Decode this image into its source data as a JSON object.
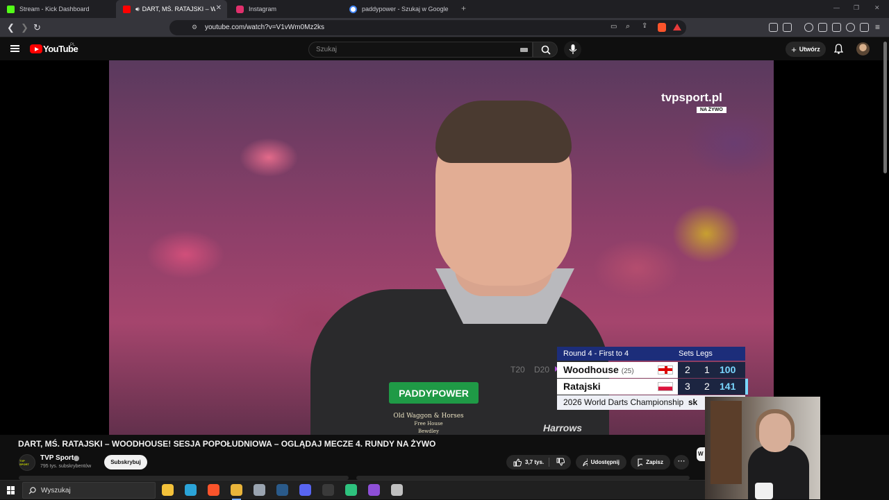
{
  "browser": {
    "tabs": [
      {
        "label": "Stream - Kick Dashboard",
        "favicon_color": "#53fc18",
        "active": false
      },
      {
        "label": "DART, MŚ. RATAJSKI – WOOD",
        "favicon_color": "#ff0000",
        "active": true,
        "muted_icon": "speaker-icon"
      },
      {
        "label": "Instagram",
        "favicon_color": "#e1306c",
        "active": false
      },
      {
        "label": "paddypower - Szukaj w Google",
        "favicon_color": "#4285f4",
        "active": false
      }
    ],
    "new_tab_symbol": "+",
    "tab_close_symbol": "✕",
    "url": "youtube.com/watch?v=V1vWm0Mz2ks"
  },
  "youtube": {
    "logo_text": "YouTube",
    "logo_region": "PL",
    "search_placeholder": "Szukaj",
    "create_label": "Utwórz"
  },
  "video": {
    "watermark": "tvpsport.pl",
    "live_tag": "NA ŻYWO",
    "sponsor": "PADDYPOWER",
    "shirt_line1": "Old Waggon & Horses",
    "shirt_line2": "Free House",
    "shirt_line3": "Bewdley",
    "shirt_harrows": "Harrows",
    "ghost_t20": "T20",
    "ghost_d20": "D20",
    "scoreboard": {
      "round": "Round 4 - First to 4",
      "sets_legs": "Sets Legs",
      "players": [
        {
          "name": "Woodhouse",
          "seed": "(25)",
          "country": "England",
          "sets": "2",
          "legs": "1",
          "points": "100",
          "throwing": true
        },
        {
          "name": "Ratajski",
          "seed": "",
          "country": "Poland",
          "sets": "3",
          "legs": "2",
          "points": "141",
          "throwing": false
        }
      ],
      "event": "2026 World Darts Championship",
      "event_suffix": "sk"
    }
  },
  "info": {
    "title": "DART, MŚ. RATAJSKI – WOODHOUSE! SESJA POPOŁUDNIOWA – OGLĄDAJ MECZE 4. RUNDY NA ŻYWO",
    "channel_name": "TVP Sport",
    "channel_avatar_text": "TVP SPORT",
    "subscribers": "795 tys. subskrybentów",
    "subscribe_label": "Subskrybuj",
    "likes": "3,7 tys.",
    "share_label": "Udostępnij",
    "save_label": "Zapisz",
    "more_label": "⋯",
    "chip_letter": "W"
  },
  "taskbar": {
    "search_placeholder": "Wyszukaj",
    "apps": [
      {
        "name": "file-explorer",
        "color": "#f3c13a"
      },
      {
        "name": "edge",
        "color": "#2ba4d8"
      },
      {
        "name": "brave",
        "color": "#fb542b"
      },
      {
        "name": "chrome",
        "color": "#e9b43a"
      },
      {
        "name": "app-generic",
        "color": "#9aa4b0"
      },
      {
        "name": "steam",
        "color": "#2a5a8a"
      },
      {
        "name": "discord",
        "color": "#5865f2"
      },
      {
        "name": "obs",
        "color": "#3a3a3a"
      },
      {
        "name": "app-green",
        "color": "#2ec27e"
      },
      {
        "name": "app-multi",
        "color": "#8e4fd8"
      },
      {
        "name": "app-grey",
        "color": "#c0c0c0"
      }
    ],
    "active_app_index": 3
  }
}
